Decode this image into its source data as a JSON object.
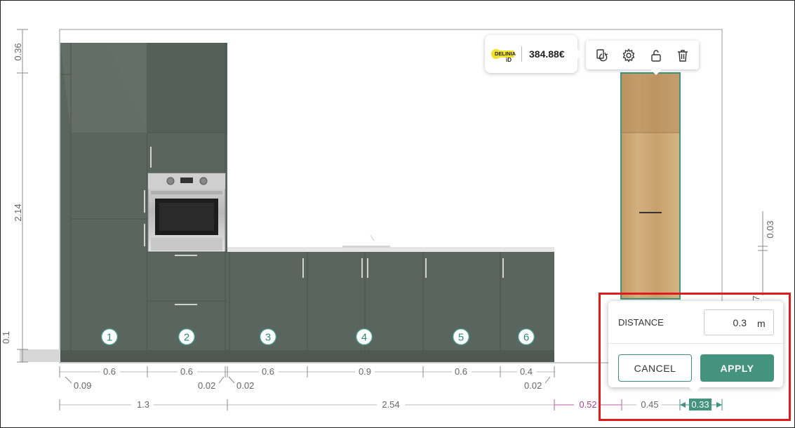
{
  "price_tooltip": {
    "brand_line1": "DELINIA",
    "brand_line2": "iD",
    "price": "384.88€"
  },
  "toolbar": {
    "icons": [
      "rotate-copy-icon",
      "gear-icon",
      "unlock-icon",
      "trash-icon"
    ]
  },
  "dimensions": {
    "vertical": {
      "top": "0.36",
      "middle": "2.14",
      "bottom_left": "0.1",
      "right_top": "0.03",
      "right_cut": "7"
    },
    "row1": [
      "0.6",
      "0.6",
      "0.6",
      "0.9",
      "0.6",
      "0.4"
    ],
    "row1_small": [
      "0.09",
      "0.02",
      "0.02",
      "0.02"
    ],
    "row2": [
      "1.3",
      "2.54"
    ],
    "row2_pink": "0.52",
    "row2_gap": "0.45",
    "row2_selected": "0.33"
  },
  "module_badges": [
    "1",
    "2",
    "3",
    "4",
    "5",
    "6"
  ],
  "distance_dialog": {
    "label": "DISTANCE",
    "value": "0.3",
    "unit": "m",
    "cancel_label": "CANCEL",
    "apply_label": "APPLY"
  },
  "colors": {
    "cabinet": "#5b6560",
    "accent": "#43937f",
    "wood": "#c9a472",
    "highlight": "#e01b1b",
    "dim_pink": "#b0418d"
  }
}
